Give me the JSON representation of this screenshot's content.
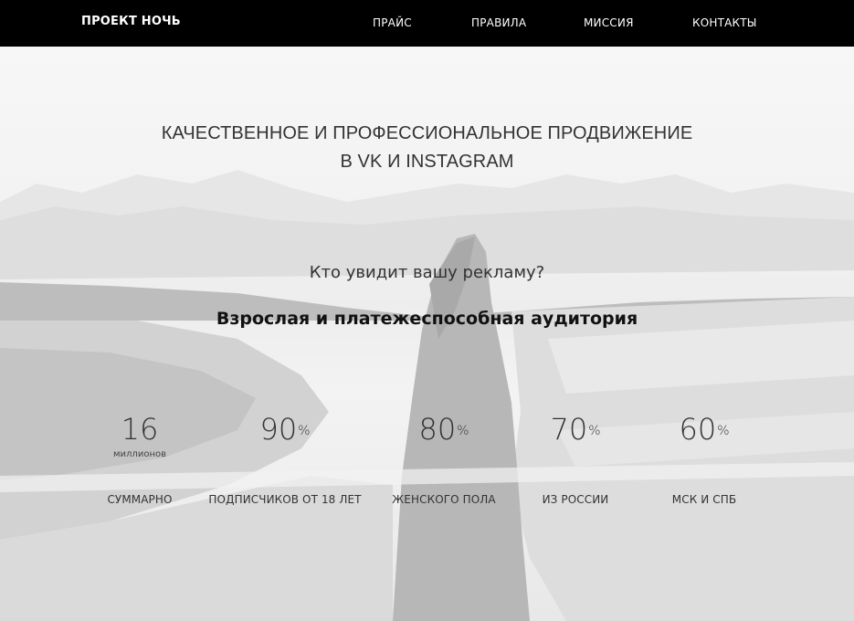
{
  "header": {
    "brand": "ПРОЕКТ НОЧЬ",
    "nav": [
      {
        "label": "ПРАЙС"
      },
      {
        "label": "ПРАВИЛА"
      },
      {
        "label": "МИССИЯ"
      },
      {
        "label": "КОНТАКТЫ"
      }
    ]
  },
  "hero": {
    "headline_line1": "КАЧЕСТВЕННОЕ И ПРОФЕССИОНАЛЬНОЕ ПРОДВИЖЕНИЕ",
    "headline_line2": "В VK И INSTAGRAM",
    "question": "Кто увидит вашу рекламу?",
    "audience": "Взрослая и платежеспособная аудитория"
  },
  "stats": [
    {
      "value": "16",
      "unit": "миллионов",
      "caption": "СУММАРНО"
    },
    {
      "value": "90",
      "suffix": "%",
      "caption": "ПОДПИСЧИКОВ ОТ 18 ЛЕТ"
    },
    {
      "value": "80",
      "suffix": "%",
      "caption": "ЖЕНСКОГО ПОЛА"
    },
    {
      "value": "70",
      "suffix": "%",
      "caption": "ИЗ РОССИИ"
    },
    {
      "value": "60",
      "suffix": "%",
      "caption": "МСК И СПБ"
    }
  ],
  "colors": {
    "header_bg": "#000000",
    "header_text": "#ffffff",
    "text": "#333333"
  }
}
